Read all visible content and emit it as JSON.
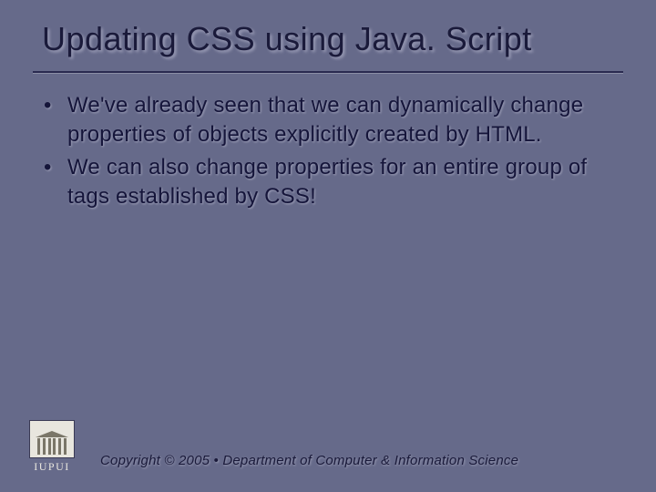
{
  "title": "Updating CSS using Java. Script",
  "bullets": [
    "We've already seen that we can dynamically change properties of objects explicitly created by HTML.",
    "We can also change properties for an entire group of tags established by CSS!"
  ],
  "footer": "Copyright © 2005 • Department of Computer & Information Science",
  "logo_text": "IUPUI"
}
